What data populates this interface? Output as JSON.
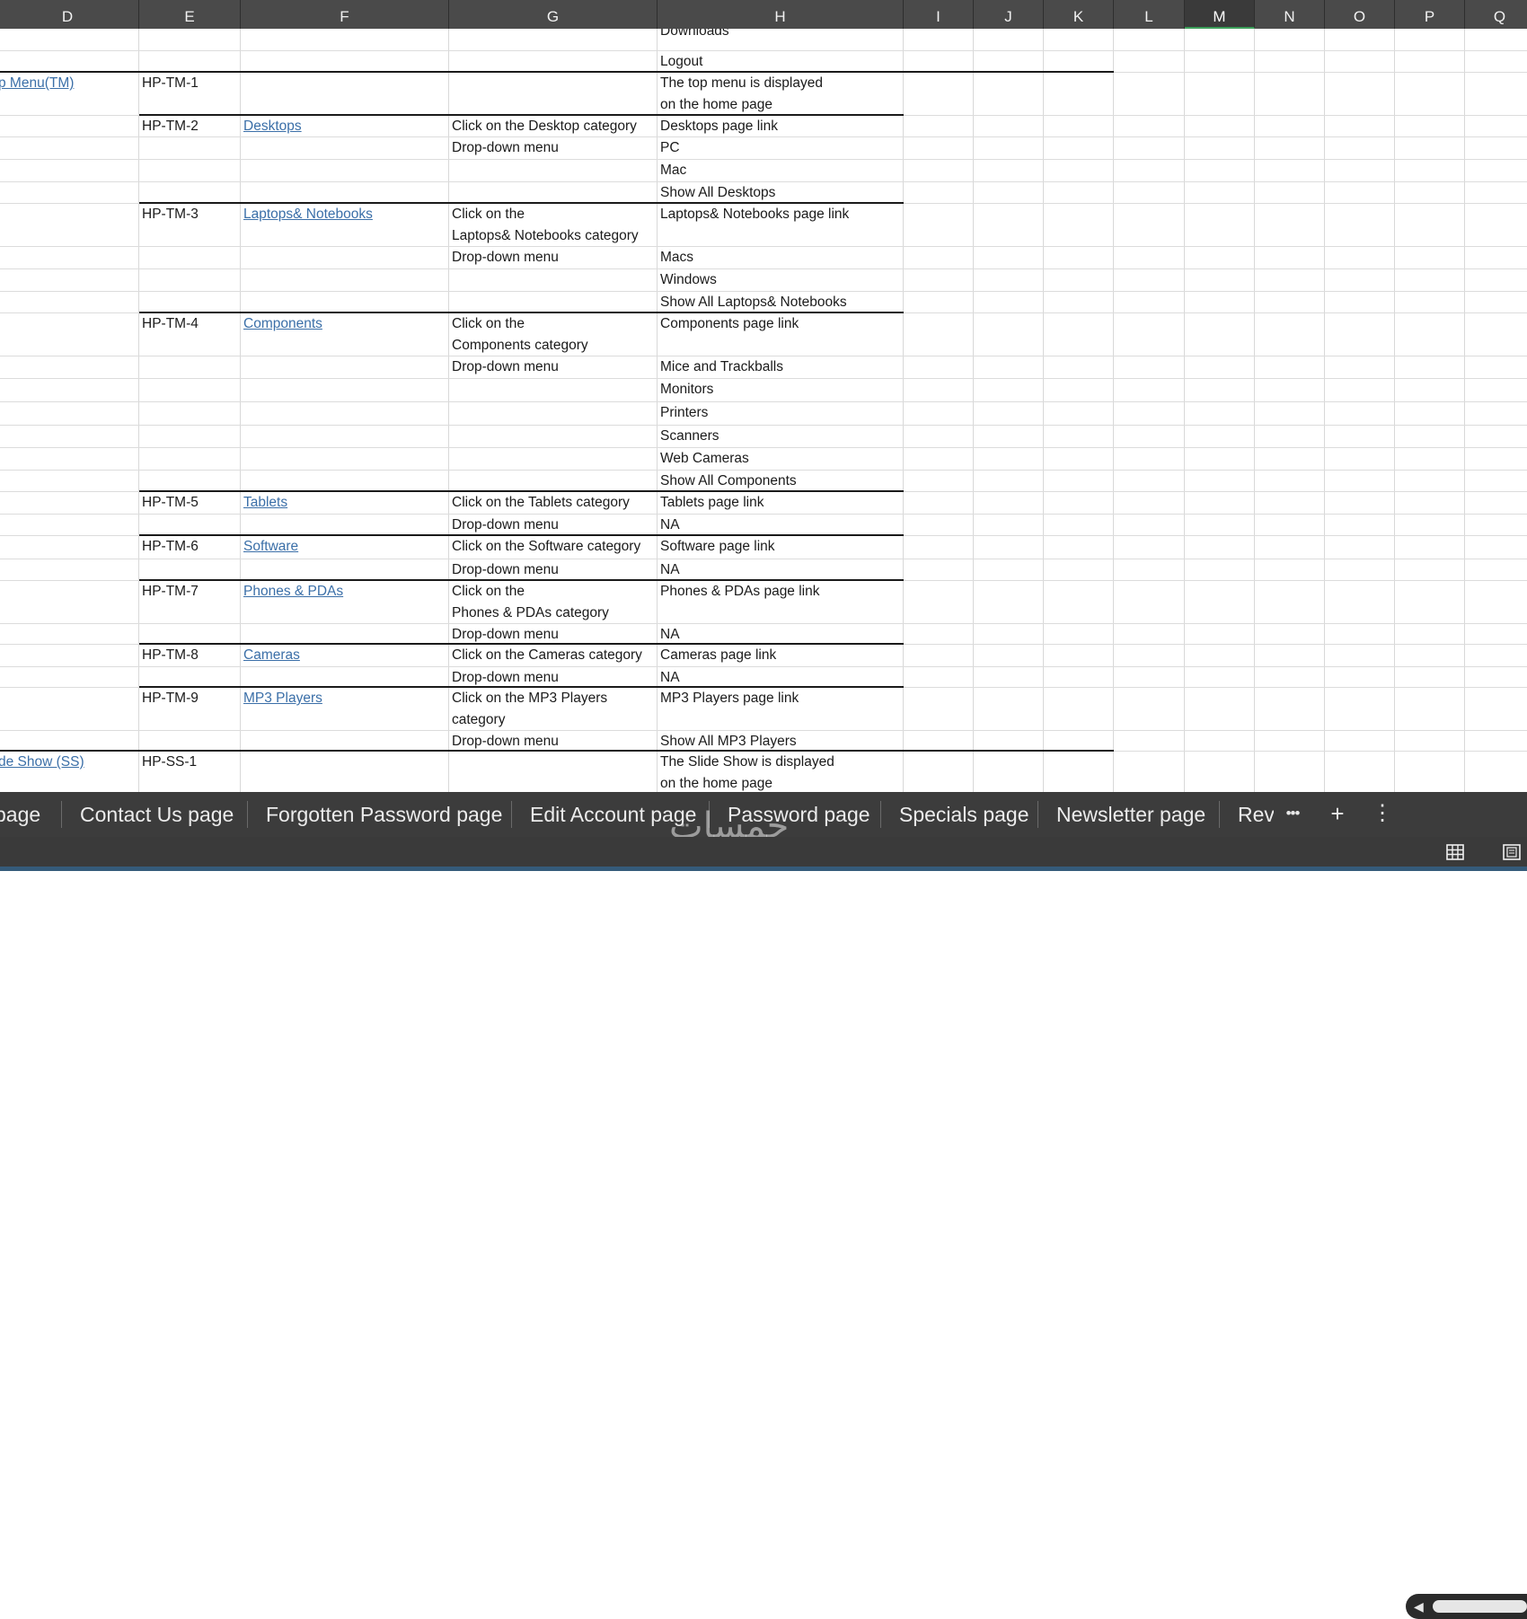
{
  "columns": [
    "D",
    "E",
    "F",
    "G",
    "H",
    "I",
    "J",
    "K",
    "L",
    "M",
    "N",
    "O",
    "P",
    "Q"
  ],
  "selected_column": "M",
  "rows": [
    {
      "h": "Downloads"
    },
    {
      "h": "Logout"
    },
    {
      "d": "p Menu(TM)",
      "e": "HP-TM-1",
      "h": "The top menu is displayed\non the home page"
    },
    {
      "e": "HP-TM-2",
      "f": "Desktops",
      "g": "Click on the Desktop category",
      "h": "Desktops page link"
    },
    {
      "g": "Drop-down menu",
      "h": "PC"
    },
    {
      "h": "Mac"
    },
    {
      "h": "Show All Desktops"
    },
    {
      "e": "HP-TM-3",
      "f": "Laptops& Notebooks",
      "g": "Click on the\nLaptops& Notebooks category",
      "h": "Laptops& Notebooks page link"
    },
    {
      "g": "Drop-down menu",
      "h": "Macs"
    },
    {
      "h": "Windows"
    },
    {
      "h": "Show All Laptops& Notebooks"
    },
    {
      "e": "HP-TM-4",
      "f": "Components",
      "g": "Click on the\nComponents category",
      "h": "Components page link"
    },
    {
      "g": "Drop-down menu",
      "h": "Mice and Trackballs"
    },
    {
      "h": "Monitors"
    },
    {
      "h": "Printers"
    },
    {
      "h": "Scanners"
    },
    {
      "h": "Web Cameras"
    },
    {
      "h": "Show All Components"
    },
    {
      "e": "HP-TM-5",
      "f": "Tablets",
      "g": "Click on the Tablets category",
      "h": "Tablets page link"
    },
    {
      "g": "Drop-down menu",
      "h": "NA"
    },
    {
      "e": "HP-TM-6",
      "f": "Software",
      "g": "Click on the Software category",
      "h": "Software page link"
    },
    {
      "g": "Drop-down menu",
      "h": "NA"
    },
    {
      "e": "HP-TM-7",
      "f": "Phones & PDAs",
      "g": "Click on the\nPhones & PDAs category",
      "h": "Phones & PDAs page link"
    },
    {
      "g": "Drop-down menu",
      "h": "NA"
    },
    {
      "e": "HP-TM-8",
      "f": "Cameras",
      "g": "Click on the Cameras category",
      "h": "Cameras page link"
    },
    {
      "g": "Drop-down menu",
      "h": "NA"
    },
    {
      "e": "HP-TM-9",
      "f": "MP3 Players",
      "g": "Click on the MP3 Players\ncategory",
      "h": "MP3 Players page link"
    },
    {
      "g": "Drop-down menu",
      "h": "Show All MP3 Players"
    },
    {
      "d": "de Show (SS)",
      "e": "HP-SS-1",
      "h": "The Slide Show is displayed\non the home page"
    }
  ],
  "sheet_tabs": [
    "page",
    "Contact Us page",
    "Forgotten Password page",
    "Edit Account page",
    "Password page",
    "Specials page",
    "Newsletter page",
    "Rev"
  ],
  "tab_controls": {
    "more": "•••",
    "add": "+",
    "options": "⋮"
  },
  "watermark": "خمسات",
  "colors": {
    "header_bg": "#4a4a4a",
    "tabbar_bg": "#3c3c3c",
    "link": "#3b6fa8",
    "selected_col_marker": "#3c9f5a"
  },
  "icons": {
    "normal_view": "grid-view-icon",
    "page_layout": "page-layout-icon",
    "scroll_left": "scroll-left-icon"
  }
}
